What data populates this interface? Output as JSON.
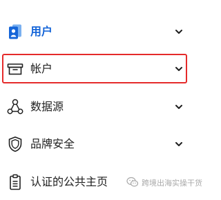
{
  "menu": {
    "items": [
      {
        "label": "用户",
        "icon": "users-icon",
        "active": true
      },
      {
        "label": "帐户",
        "icon": "archive-box-icon",
        "active": false
      },
      {
        "label": "数据源",
        "icon": "data-source-icon",
        "active": false
      },
      {
        "label": "品牌安全",
        "icon": "shield-icon",
        "active": false
      },
      {
        "label": "认证的公共主页",
        "icon": "clipboard-icon",
        "active": false
      }
    ]
  },
  "colors": {
    "active_text": "#1565d8",
    "highlight_border": "#e52a2a",
    "text": "#1f1f1f"
  },
  "watermark": {
    "text": "跨境出海实操干货",
    "icon": "wechat-icon"
  }
}
